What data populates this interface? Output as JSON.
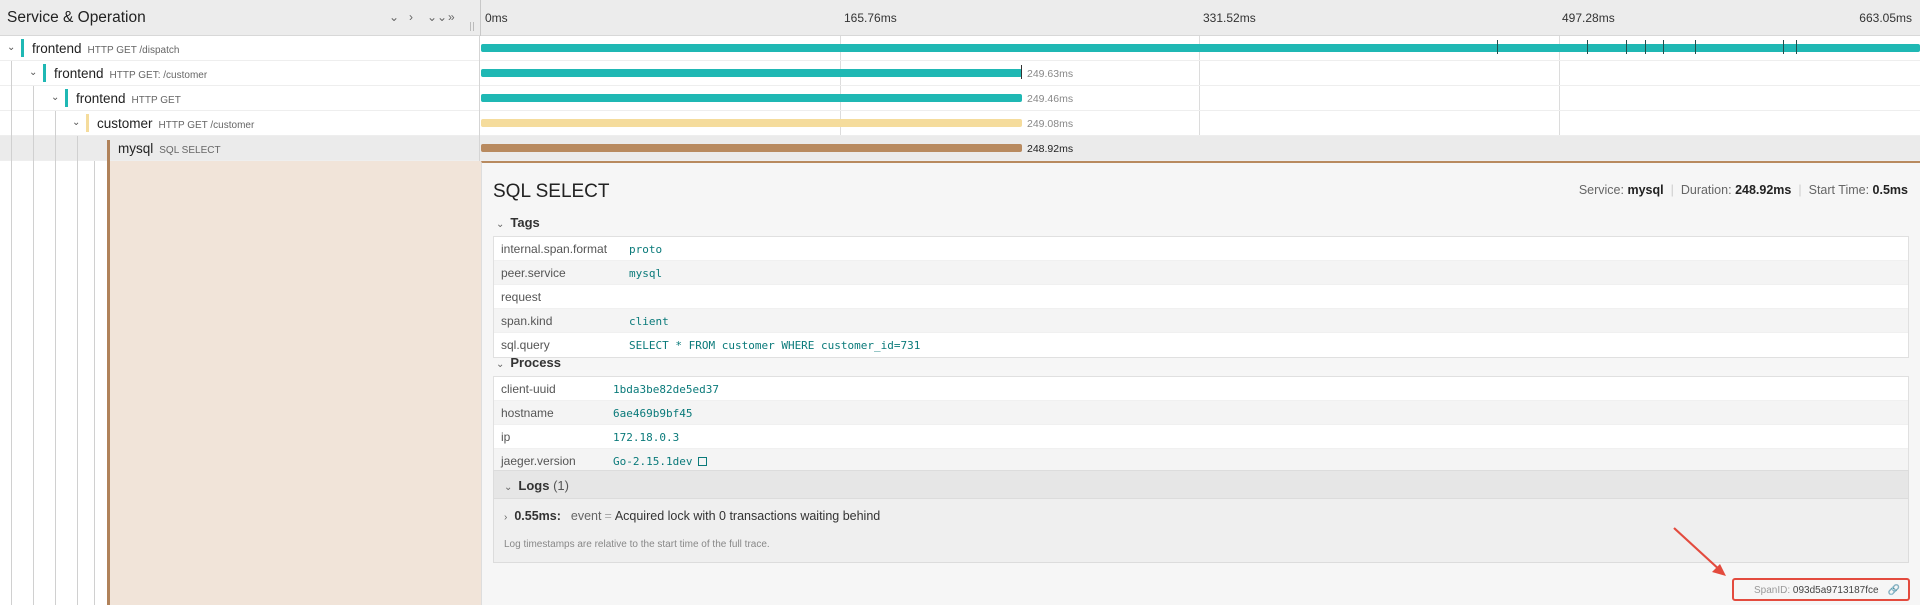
{
  "header": {
    "title": "Service & Operation",
    "ticks": [
      "0ms",
      "165.76ms",
      "331.52ms",
      "497.28ms",
      "663.05ms"
    ]
  },
  "spans": [
    {
      "service": "frontend",
      "operation": "HTTP GET /dispatch",
      "duration": "",
      "color": "#1fb8b4"
    },
    {
      "service": "frontend",
      "operation": "HTTP GET: /customer",
      "duration": "249.63ms",
      "color": "#1fb8b4"
    },
    {
      "service": "frontend",
      "operation": "HTTP GET",
      "duration": "249.46ms",
      "color": "#1fb8b4"
    },
    {
      "service": "customer",
      "operation": "HTTP GET /customer",
      "duration": "249.08ms",
      "color": "#f5dc9c"
    },
    {
      "service": "mysql",
      "operation": "SQL SELECT",
      "duration": "248.92ms",
      "color": "#b88a5f"
    }
  ],
  "detail": {
    "title": "SQL SELECT",
    "service_label": "Service:",
    "service": "mysql",
    "duration_label": "Duration:",
    "duration": "248.92ms",
    "start_label": "Start Time:",
    "start": "0.5ms",
    "tags_title": "Tags",
    "tags": [
      {
        "key": "internal.span.format",
        "value": "proto"
      },
      {
        "key": "peer.service",
        "value": "mysql"
      },
      {
        "key": "request",
        "value": ""
      },
      {
        "key": "span.kind",
        "value": "client"
      },
      {
        "key": "sql.query",
        "value": "SELECT * FROM customer WHERE customer_id=731"
      }
    ],
    "process_title": "Process",
    "process": [
      {
        "key": "client-uuid",
        "value": "1bda3be82de5ed37"
      },
      {
        "key": "hostname",
        "value": "6ae469b9bf45"
      },
      {
        "key": "ip",
        "value": "172.18.0.3"
      },
      {
        "key": "jaeger.version",
        "value": "Go-2.15.1dev"
      }
    ],
    "logs_title": "Logs",
    "logs_count": "(1)",
    "log": {
      "timestamp": "0.55ms:",
      "key": "event",
      "value": "Acquired lock with 0 transactions waiting behind"
    },
    "logs_note": "Log timestamps are relative to the start time of the full trace.",
    "spanid_label": "SpanID:",
    "spanid": "093d5a9713187fce"
  },
  "colors": {
    "frontend": "#1fb8b4",
    "customer": "#f5dc9c",
    "mysql": "#b88a5f",
    "highlight": "#e34b3e"
  }
}
